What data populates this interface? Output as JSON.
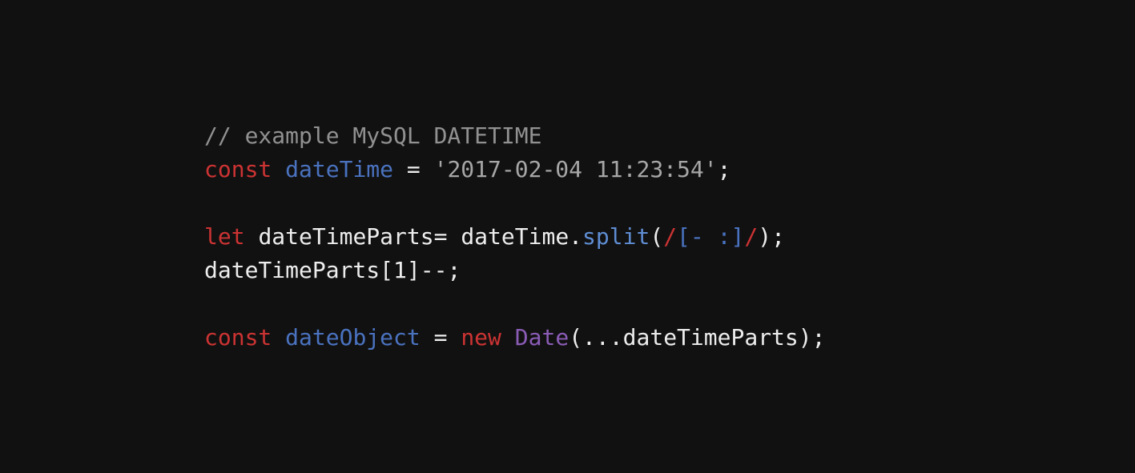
{
  "code": {
    "line1": {
      "comment": "// example MySQL DATETIME"
    },
    "line2": {
      "kw_const": "const",
      "space1": " ",
      "id_dateTime": "dateTime",
      "space2": " ",
      "eq": "=",
      "space3": " ",
      "str": "'2017-02-04 11:23:54'",
      "semi": ";"
    },
    "line4": {
      "kw_let": "let",
      "space1": " ",
      "id_dateTimeParts": "dateTimeParts",
      "eq": "=",
      "space2": " ",
      "id_dateTime": "dateTime",
      "dot": ".",
      "method_split": "split",
      "lparen": "(",
      "regex_open": "/",
      "regex_class": "[- :]",
      "regex_close": "/",
      "rparen": ")",
      "semi": ";"
    },
    "line5": {
      "id": "dateTimeParts",
      "lbracket": "[",
      "num": "1",
      "rbracket": "]",
      "dec": "--",
      "semi": ";"
    },
    "line7": {
      "kw_const": "const",
      "space1": " ",
      "id_dateObject": "dateObject",
      "space2": " ",
      "eq": "=",
      "space3": " ",
      "kw_new": "new",
      "space4": " ",
      "type_Date": "Date",
      "lparen": "(",
      "spread": "...",
      "id_dateTimeParts": "dateTimeParts",
      "rparen": ")",
      "semi": ";"
    }
  }
}
